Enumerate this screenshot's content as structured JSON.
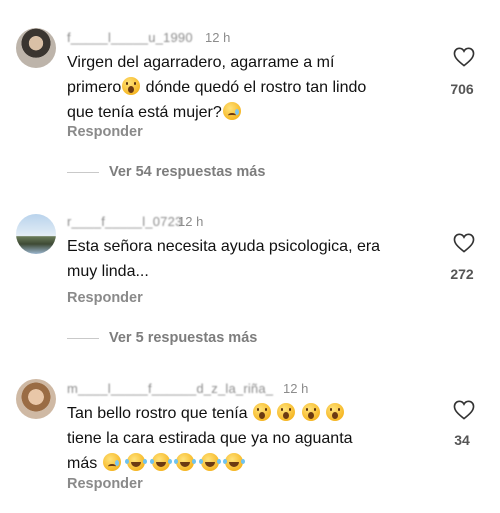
{
  "comments": [
    {
      "username": "f_____l_____u_1990",
      "time": "12 h",
      "line1": "Virgen del agarradero, agarrame a mí",
      "line2a": "primero",
      "line2b": " dónde quedó el rostro tan lindo",
      "line3": "que tenía está mujer?",
      "likes": "706",
      "reply_label": "Responder",
      "more_replies": "Ver 54 respuestas más"
    },
    {
      "username": "r____f_____l_0723",
      "time": "12 h",
      "line1": "Esta señora necesita ayuda psicologica, era",
      "line2": "muy linda...",
      "likes": "272",
      "reply_label": "Responder",
      "more_replies": "Ver 5 respuestas más"
    },
    {
      "username": "m____l_____f______d_z_la_riña_",
      "time": "12 h",
      "line1": "Tan bello rostro que tenía",
      "line2": "tiene la cara estirada que ya no aguanta",
      "line3": "más",
      "likes": "34",
      "reply_label": "Responder"
    }
  ],
  "icons": {
    "like": "heart-outline-icon",
    "emoji_wow": "face-open-mouth-emoji",
    "emoji_cry": "crying-face-emoji",
    "emoji_joy": "tears-of-joy-emoji"
  },
  "colors": {
    "secondary_text": "#8c8c8c",
    "primary_text": "#111111"
  }
}
